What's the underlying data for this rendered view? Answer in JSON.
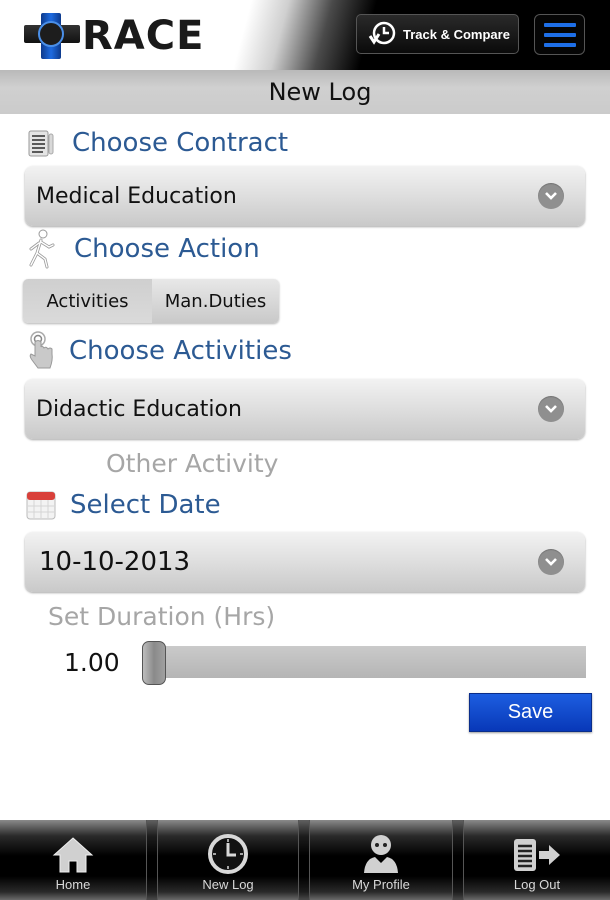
{
  "header": {
    "logo_text": "RACE",
    "track_compare_label": "Track & Compare",
    "menu_icon": "hamburger-menu-icon"
  },
  "page": {
    "title": "New Log"
  },
  "contract": {
    "heading": "Choose Contract",
    "icon": "document-icon",
    "selected": "Medical Education"
  },
  "action": {
    "heading": "Choose Action",
    "icon": "walking-person-icon",
    "options": [
      {
        "label": "Activities",
        "active": true
      },
      {
        "label": "Man.Duties",
        "active": false
      }
    ]
  },
  "activities": {
    "heading": "Choose Activities",
    "icon": "touch-finger-icon",
    "selected": "Didactic Education",
    "other_label": "Other Activity"
  },
  "date": {
    "heading": "Select Date",
    "icon": "calendar-icon",
    "selected": "10-10-2013"
  },
  "duration": {
    "label": "Set Duration (Hrs)",
    "value": "1.00",
    "slider_fraction": 0.0
  },
  "save_label": "Save",
  "bottom_nav": [
    {
      "label": "Home",
      "icon": "home-icon"
    },
    {
      "label": "New Log",
      "icon": "clock-icon"
    },
    {
      "label": "My Profile",
      "icon": "user-icon"
    },
    {
      "label": "Log Out",
      "icon": "logout-icon"
    }
  ],
  "colors": {
    "heading_blue": "#2c5a93",
    "accent_blue": "#1e6fe8",
    "save_blue": "#0838b8",
    "muted_gray": "#a6a6a6"
  }
}
